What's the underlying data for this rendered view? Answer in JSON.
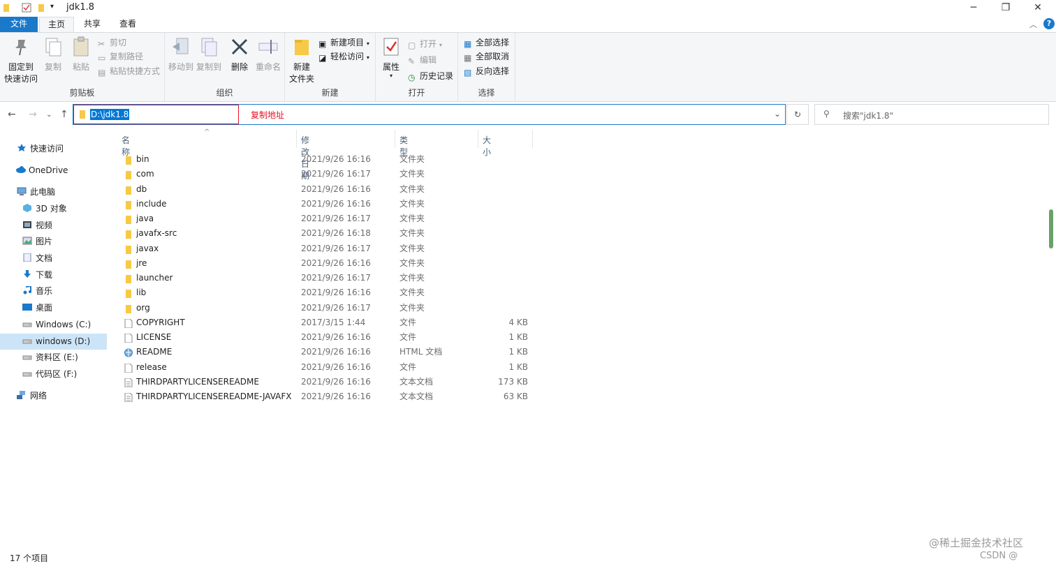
{
  "window": {
    "title": "jdk1.8",
    "minimize": "─",
    "restore": "❐",
    "close": "✕"
  },
  "tabs": {
    "file": "文件",
    "home": "主页",
    "share": "共享",
    "view": "查看"
  },
  "ribbon": {
    "clipboard": {
      "label": "剪贴板",
      "pin": "固定到\n快速访问",
      "pin_l1": "固定到",
      "pin_l2": "快速访问",
      "copy": "复制",
      "paste": "粘贴",
      "cut": "剪切",
      "copy_path": "复制路径",
      "paste_shortcut": "粘贴快捷方式"
    },
    "organize": {
      "label": "组织",
      "move_to": "移动到",
      "copy_to": "复制到",
      "delete": "删除",
      "rename": "重命名"
    },
    "new": {
      "label": "新建",
      "new_folder_l1": "新建",
      "new_folder_l2": "文件夹",
      "new_item": "新建项目",
      "easy_access": "轻松访问"
    },
    "open": {
      "label": "打开",
      "properties": "属性",
      "open": "打开",
      "edit": "编辑",
      "history": "历史记录"
    },
    "select": {
      "label": "选择",
      "select_all": "全部选择",
      "select_none": "全部取消",
      "invert": "反向选择"
    }
  },
  "address": {
    "path": "D:\\jdk1.8",
    "annotation": "复制地址",
    "search_placeholder": "搜索\"jdk1.8\""
  },
  "navpane": [
    {
      "label": "快速访问",
      "icon": "star-icon",
      "selected": false
    },
    {
      "label": "OneDrive",
      "icon": "cloud-icon",
      "selected": false
    },
    {
      "label": "此电脑",
      "icon": "computer-icon",
      "selected": false
    },
    {
      "label": "3D 对象",
      "icon": "cube-icon",
      "selected": false
    },
    {
      "label": "视频",
      "icon": "video-icon",
      "selected": false
    },
    {
      "label": "图片",
      "icon": "picture-icon",
      "selected": false
    },
    {
      "label": "文档",
      "icon": "document-icon",
      "selected": false
    },
    {
      "label": "下载",
      "icon": "download-icon",
      "selected": false
    },
    {
      "label": "音乐",
      "icon": "music-icon",
      "selected": false
    },
    {
      "label": "桌面",
      "icon": "desktop-icon",
      "selected": false
    },
    {
      "label": "Windows  (C:)",
      "icon": "drive-icon",
      "selected": false
    },
    {
      "label": "windows (D:)",
      "icon": "drive-icon",
      "selected": true
    },
    {
      "label": "资料区 (E:)",
      "icon": "drive-icon",
      "selected": false
    },
    {
      "label": "代码区 (F:)",
      "icon": "drive-icon",
      "selected": false
    },
    {
      "label": "网络",
      "icon": "network-icon",
      "selected": false
    }
  ],
  "columns": {
    "name": "名称",
    "date": "修改日期",
    "type": "类型",
    "size": "大小"
  },
  "files": [
    {
      "name": "bin",
      "date": "2021/9/26 16:16",
      "type": "文件夹",
      "size": "",
      "kind": "folder"
    },
    {
      "name": "com",
      "date": "2021/9/26 16:17",
      "type": "文件夹",
      "size": "",
      "kind": "folder"
    },
    {
      "name": "db",
      "date": "2021/9/26 16:16",
      "type": "文件夹",
      "size": "",
      "kind": "folder"
    },
    {
      "name": "include",
      "date": "2021/9/26 16:16",
      "type": "文件夹",
      "size": "",
      "kind": "folder"
    },
    {
      "name": "java",
      "date": "2021/9/26 16:17",
      "type": "文件夹",
      "size": "",
      "kind": "folder"
    },
    {
      "name": "javafx-src",
      "date": "2021/9/26 16:18",
      "type": "文件夹",
      "size": "",
      "kind": "folder"
    },
    {
      "name": "javax",
      "date": "2021/9/26 16:17",
      "type": "文件夹",
      "size": "",
      "kind": "folder"
    },
    {
      "name": "jre",
      "date": "2021/9/26 16:16",
      "type": "文件夹",
      "size": "",
      "kind": "folder"
    },
    {
      "name": "launcher",
      "date": "2021/9/26 16:17",
      "type": "文件夹",
      "size": "",
      "kind": "folder"
    },
    {
      "name": "lib",
      "date": "2021/9/26 16:16",
      "type": "文件夹",
      "size": "",
      "kind": "folder"
    },
    {
      "name": "org",
      "date": "2021/9/26 16:17",
      "type": "文件夹",
      "size": "",
      "kind": "folder"
    },
    {
      "name": "COPYRIGHT",
      "date": "2017/3/15 1:44",
      "type": "文件",
      "size": "4 KB",
      "kind": "file"
    },
    {
      "name": "LICENSE",
      "date": "2021/9/26 16:16",
      "type": "文件",
      "size": "1 KB",
      "kind": "file"
    },
    {
      "name": "README",
      "date": "2021/9/26 16:16",
      "type": "HTML 文档",
      "size": "1 KB",
      "kind": "html"
    },
    {
      "name": "release",
      "date": "2021/9/26 16:16",
      "type": "文件",
      "size": "1 KB",
      "kind": "file"
    },
    {
      "name": "THIRDPARTYLICENSEREADME",
      "date": "2021/9/26 16:16",
      "type": "文本文档",
      "size": "173 KB",
      "kind": "text"
    },
    {
      "name": "THIRDPARTYLICENSEREADME-JAVAFX",
      "date": "2021/9/26 16:16",
      "type": "文本文档",
      "size": "63 KB",
      "kind": "text"
    }
  ],
  "status": {
    "count": "17 个项目"
  },
  "watermark": {
    "line1": "@稀土掘金技术社区",
    "line2": "CSDN @"
  },
  "colors": {
    "accent": "#1979ca",
    "selection": "#cce4f7",
    "folder": "#f7c948",
    "annotation_red": "#e81123"
  }
}
